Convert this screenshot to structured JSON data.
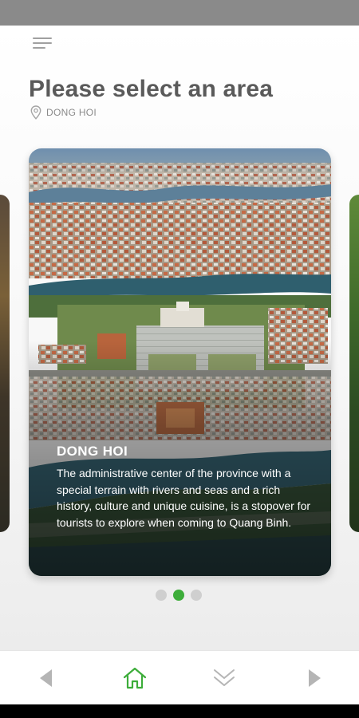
{
  "header": {
    "title": "Please select an area",
    "location": "DONG HOI"
  },
  "carousel": {
    "active_index": 1,
    "count": 3,
    "card": {
      "title": "DONG HOI",
      "description": "The administrative center of the province with a special terrain with rivers and seas and a rich history, culture and unique cuisine, is a stopover for tourists to explore when coming to Quang Binh."
    }
  },
  "bottom_nav": {
    "items": [
      "prev-arrow-icon",
      "home-icon",
      "chevron-double-down-icon",
      "next-arrow-icon"
    ]
  },
  "colors": {
    "accent": "#3dad3a",
    "title": "#5a5a5a",
    "inactive_dot": "#cfcfcf",
    "nav_icon": "#b5b5b5"
  }
}
